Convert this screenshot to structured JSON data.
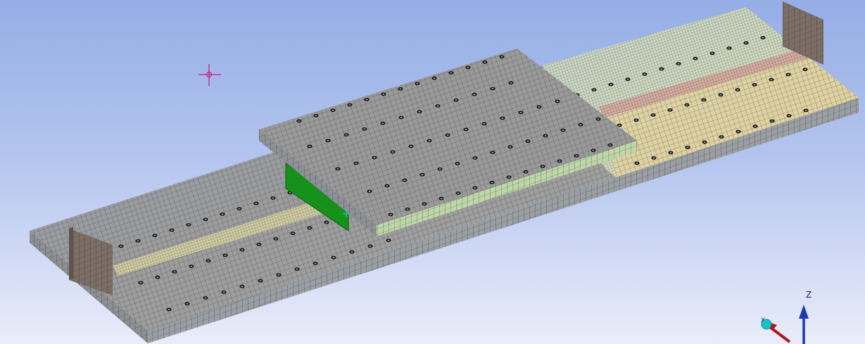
{
  "viewport": {
    "background_top": "#95aee6",
    "background_bottom": "#e9edfa"
  },
  "model": {
    "mesh_color_base": "#9a9a9a",
    "mesh_color_blue_region": "#8e9cb0",
    "mesh_color_mint_region": "#c3d2c3",
    "mesh_color_tan_region": "#e2d3a0",
    "mesh_color_pink_strip": "#d5a79c",
    "mesh_color_brown_support": "#7d6e66",
    "selected_face_color": "#15951a",
    "mesh_line_color": "#2a2a2a"
  },
  "cursor": {
    "icon": "crosshair-target-icon",
    "color": "#c8227a"
  },
  "triad": {
    "z_label": "Z",
    "x_label": "X",
    "z_color": "#1a3ab0",
    "x_color": "#b01818",
    "origin_color": "#19c2c9"
  }
}
